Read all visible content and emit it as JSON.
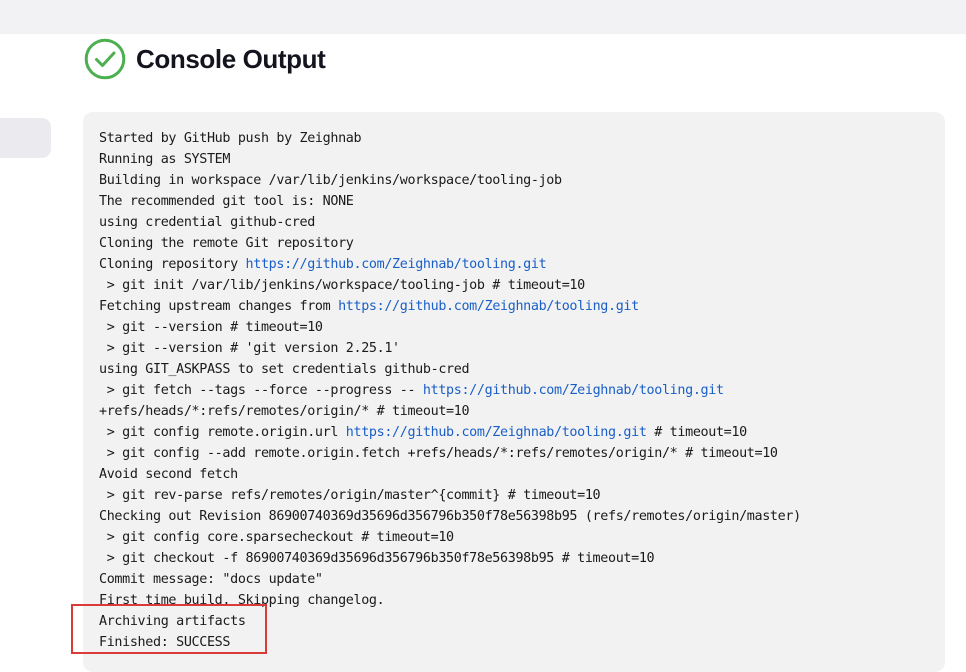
{
  "page": {
    "title": "Console Output",
    "status_icon": "success-check-icon",
    "status_color": "#4caf50"
  },
  "console": {
    "lines": [
      {
        "segments": [
          {
            "text": "Started by GitHub push by Zeighnab",
            "type": "text"
          }
        ]
      },
      {
        "segments": [
          {
            "text": "Running as SYSTEM",
            "type": "text"
          }
        ]
      },
      {
        "segments": [
          {
            "text": "Building in workspace /var/lib/jenkins/workspace/tooling-job",
            "type": "text"
          }
        ]
      },
      {
        "segments": [
          {
            "text": "The recommended git tool is: NONE",
            "type": "text"
          }
        ]
      },
      {
        "segments": [
          {
            "text": "using credential github-cred",
            "type": "text"
          }
        ]
      },
      {
        "segments": [
          {
            "text": "Cloning the remote Git repository",
            "type": "text"
          }
        ]
      },
      {
        "segments": [
          {
            "text": "Cloning repository ",
            "type": "text"
          },
          {
            "text": "https://github.com/Zeighnab/tooling.git",
            "type": "link"
          }
        ]
      },
      {
        "segments": [
          {
            "text": " > git init /var/lib/jenkins/workspace/tooling-job # timeout=10",
            "type": "text"
          }
        ]
      },
      {
        "segments": [
          {
            "text": "Fetching upstream changes from ",
            "type": "text"
          },
          {
            "text": "https://github.com/Zeighnab/tooling.git",
            "type": "link"
          }
        ]
      },
      {
        "segments": [
          {
            "text": " > git --version # timeout=10",
            "type": "text"
          }
        ]
      },
      {
        "segments": [
          {
            "text": " > git --version # 'git version 2.25.1'",
            "type": "text"
          }
        ]
      },
      {
        "segments": [
          {
            "text": "using GIT_ASKPASS to set credentials github-cred",
            "type": "text"
          }
        ]
      },
      {
        "segments": [
          {
            "text": " > git fetch --tags --force --progress -- ",
            "type": "text"
          },
          {
            "text": "https://github.com/Zeighnab/tooling.git",
            "type": "link"
          }
        ]
      },
      {
        "segments": [
          {
            "text": "+refs/heads/*:refs/remotes/origin/* # timeout=10",
            "type": "text"
          }
        ]
      },
      {
        "segments": [
          {
            "text": " > git config remote.origin.url ",
            "type": "text"
          },
          {
            "text": "https://github.com/Zeighnab/tooling.git",
            "type": "link"
          },
          {
            "text": " # timeout=10",
            "type": "text"
          }
        ]
      },
      {
        "segments": [
          {
            "text": " > git config --add remote.origin.fetch +refs/heads/*:refs/remotes/origin/* # timeout=10",
            "type": "text"
          }
        ]
      },
      {
        "segments": [
          {
            "text": "Avoid second fetch",
            "type": "text"
          }
        ]
      },
      {
        "segments": [
          {
            "text": " > git rev-parse refs/remotes/origin/master^{commit} # timeout=10",
            "type": "text"
          }
        ]
      },
      {
        "segments": [
          {
            "text": "Checking out Revision 86900740369d35696d356796b350f78e56398b95 (refs/remotes/origin/master)",
            "type": "text"
          }
        ]
      },
      {
        "segments": [
          {
            "text": " > git config core.sparsecheckout # timeout=10",
            "type": "text"
          }
        ]
      },
      {
        "segments": [
          {
            "text": " > git checkout -f 86900740369d35696d356796b350f78e56398b95 # timeout=10",
            "type": "text"
          }
        ]
      },
      {
        "segments": [
          {
            "text": "Commit message: \"docs update\"",
            "type": "text"
          }
        ]
      },
      {
        "segments": [
          {
            "text": "First time build. Skipping changelog.",
            "type": "text"
          }
        ]
      },
      {
        "segments": [
          {
            "text": "Archiving artifacts",
            "type": "text"
          }
        ]
      },
      {
        "segments": [
          {
            "text": "Finished: SUCCESS",
            "type": "text"
          }
        ]
      }
    ]
  },
  "colors": {
    "link": "#1a5fc7",
    "annotation_box": "#d93c37",
    "console_bg": "#f2f2f3"
  }
}
